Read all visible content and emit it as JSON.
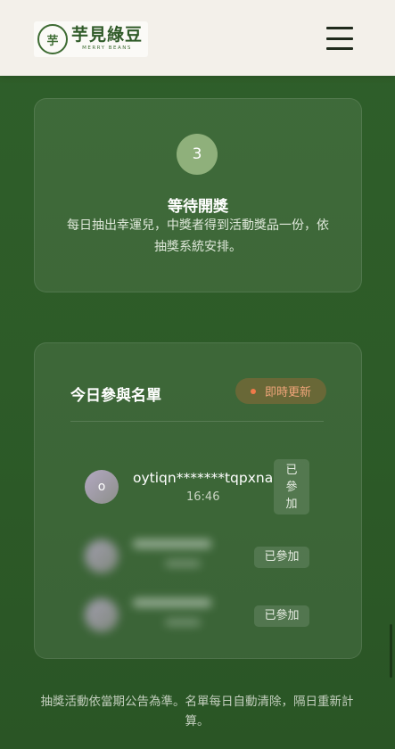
{
  "header": {
    "logo_mark": "芋",
    "logo_name": "芋見綠豆",
    "logo_tagline": "MERRY BEANS",
    "menu_icon": "hamburger-menu-icon"
  },
  "step": {
    "number": "3",
    "title": "等待開獎",
    "description": "每日抽出幸運兒，中獎者得到活動獎品一份，依抽獎系統安排。"
  },
  "participants": {
    "title": "今日參與名單",
    "live_label": "即時更新",
    "live_color": "#f07a4a",
    "items": [
      {
        "avatar": "o",
        "name": "oytiqn*******tqpxna",
        "time": "16:46",
        "status": "已參加"
      },
      {
        "status": "已參加"
      },
      {
        "status": "已參加"
      }
    ]
  },
  "footer": {
    "note": "抽獎活動依當期公告為準。名單每日自動清除，隔日重新計算。"
  },
  "colors": {
    "background": "#2d5b28",
    "step_circle": "#8fb07b",
    "header_bg": "#f3f0ea"
  }
}
